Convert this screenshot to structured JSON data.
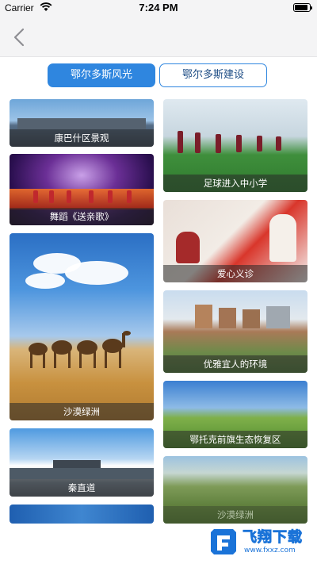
{
  "status_bar": {
    "carrier": "Carrier",
    "time": "7:24 PM",
    "battery_level": 0.9
  },
  "nav": {
    "back_icon": "chevron-left-icon"
  },
  "tabs": [
    {
      "label": "鄂尔多斯风光",
      "selected": true
    },
    {
      "label": "鄂尔多斯建设",
      "selected": false
    }
  ],
  "colors": {
    "accent": "#2f86df",
    "tab_text_unselected": "#1f4e86",
    "nav_background": "#f4f4f5"
  },
  "gallery": {
    "left_column": [
      {
        "caption": "康巴什区景观"
      },
      {
        "caption": "舞蹈《送亲歌》"
      },
      {
        "caption": "沙漠绿洲"
      },
      {
        "caption": "秦直道"
      },
      {
        "caption": ""
      }
    ],
    "right_column": [
      {
        "caption": "足球进入中小学"
      },
      {
        "caption": "爱心义诊"
      },
      {
        "caption": "优雅宜人的环境"
      },
      {
        "caption": "鄂托克前旗生态恢复区"
      },
      {
        "caption": "沙漠绿洲"
      }
    ]
  },
  "watermark": {
    "title": "飞翔下载",
    "url": "www.fxxz.com"
  }
}
